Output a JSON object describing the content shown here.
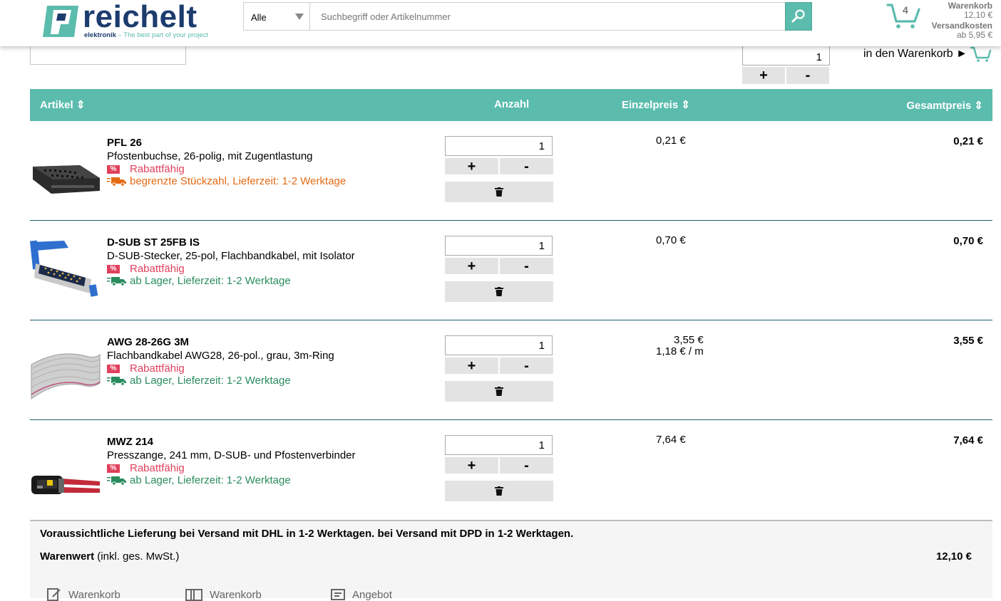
{
  "header": {
    "logo": {
      "word": "reichelt",
      "sub_bold": "elektronik",
      "sub_tag": "– The best part of your project"
    },
    "search": {
      "category": "Alle",
      "placeholder": "Suchbegriff oder Artikelnummer"
    },
    "cart": {
      "count": "4",
      "label": "Warenkorb",
      "amount": "12,10 €",
      "shipping_label": "Versandkosten",
      "shipping_value": "ab 5,95 €"
    }
  },
  "quick_add": {
    "qty": "1",
    "plus": "+",
    "minus": "-",
    "add_label": "in den Warenkorb ►"
  },
  "table": {
    "headers": {
      "artikel": "Artikel ⇕",
      "anzahl": "Anzahl",
      "einzelpreis": "Einzelpreis ⇕",
      "gesamtpreis": "Gesamtpreis ⇕"
    },
    "rows": [
      {
        "name": "PFL 26",
        "desc": "Pfostenbuchse, 26-polig, mit Zugentlastung",
        "rabatt": "Rabattfähig",
        "availability": "begrenzte Stückzahl,  Lieferzeit: 1-2 Werktage",
        "qty": "1",
        "unit_price": "0,21 €",
        "unit_price_2": "",
        "total": "0,21 €"
      },
      {
        "name": "D-SUB ST 25FB IS",
        "desc": "D-SUB-Stecker, 25-pol, Flachbandkabel, mit Isolator",
        "rabatt": "Rabattfähig",
        "availability": "ab Lager,  Lieferzeit: 1-2 Werktage",
        "qty": "1",
        "unit_price": "0,70 €",
        "unit_price_2": "",
        "total": "0,70 €"
      },
      {
        "name": "AWG 28-26G 3M",
        "desc": "Flachbandkabel AWG28, 26-pol., grau, 3m-Ring",
        "rabatt": "Rabattfähig",
        "availability": "ab Lager,  Lieferzeit: 1-2 Werktage",
        "qty": "1",
        "unit_price": "3,55 €",
        "unit_price_2": "1,18 € / m",
        "total": "3,55 €"
      },
      {
        "name": "MWZ 214",
        "desc": "Presszange, 241 mm, D-SUB- und Pfostenverbinder",
        "rabatt": "Rabattfähig",
        "availability": "ab Lager,  Lieferzeit: 1-2 Werktage",
        "qty": "1",
        "unit_price": "7,64 €",
        "unit_price_2": "",
        "total": "7,64 €"
      }
    ],
    "plus": "+",
    "minus": "-"
  },
  "summary": {
    "delivery": "Voraussichtliche Lieferung bei Versand mit DHL in 1-2 Werktagen. bei Versand mit DPD in 1-2 Werktagen.",
    "warenwert_label": "Warenwert",
    "warenwert_note": " (inkl. ges. MwSt.)",
    "warenwert_value": "12,10 €",
    "actions": [
      "Warenkorb",
      "Warenkorb",
      "Angebot"
    ]
  },
  "colors": {
    "brand_teal": "#5bbcae",
    "brand_navy": "#1d3c6e",
    "rabatt": "#e0405c",
    "orange": "#e36a13",
    "green": "#2a8c5e"
  }
}
